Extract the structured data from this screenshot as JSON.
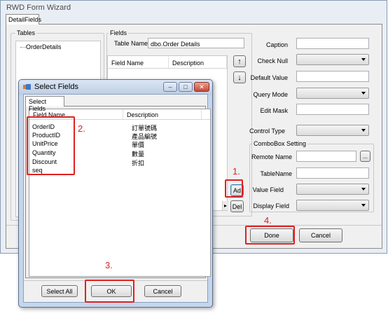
{
  "main": {
    "title": "RWD Form Wizard",
    "tab": "DetailFields",
    "tables_group": "Tables",
    "tables_item": "OrderDetails",
    "fields_group": "Fields",
    "table_name_label": "Table Name:",
    "table_name_value": "dbo.Order Details",
    "grid_headers": [
      "Field Name",
      "Description"
    ],
    "up_arrow": "↑",
    "down_arrow": "↓",
    "add_button": "Ad",
    "del_button": "Del",
    "scroll_arrow": "▸",
    "done_button": "Done",
    "cancel_button": "Cancel"
  },
  "props": {
    "caption": "Caption",
    "check_null": "Check Null",
    "default_value": "Default Value",
    "query_mode": "Query Mode",
    "edit_mask": "Edit Mask",
    "control_type": "Control Type",
    "combobox_group": "ComboBox Setting",
    "remote_name": "Remote Name",
    "remote_btn": "...",
    "table_name": "TableName",
    "value_field": "Value Field",
    "display_field": "Display Field"
  },
  "dialog": {
    "title": "Select Fields",
    "tab": "Select Fields",
    "minimize": "–",
    "maximize": "□",
    "close": "✕",
    "headers": [
      "Field Name",
      "Description"
    ],
    "rows": [
      {
        "field": "OrderID",
        "desc": "訂單號碼"
      },
      {
        "field": "ProductID",
        "desc": "產品編號"
      },
      {
        "field": "UnitPrice",
        "desc": "單價"
      },
      {
        "field": "Quantity",
        "desc": "數量"
      },
      {
        "field": "Discount",
        "desc": "折扣"
      },
      {
        "field": "seq",
        "desc": ""
      }
    ],
    "select_all": "Select All",
    "ok": "OK",
    "cancel": "Cancel"
  },
  "steps": {
    "s1": "1.",
    "s2": "2.",
    "s3": "3.",
    "s4": "4."
  },
  "colors": {
    "annotation_red": "#e02020",
    "window_frame": "#c5d6ec"
  }
}
